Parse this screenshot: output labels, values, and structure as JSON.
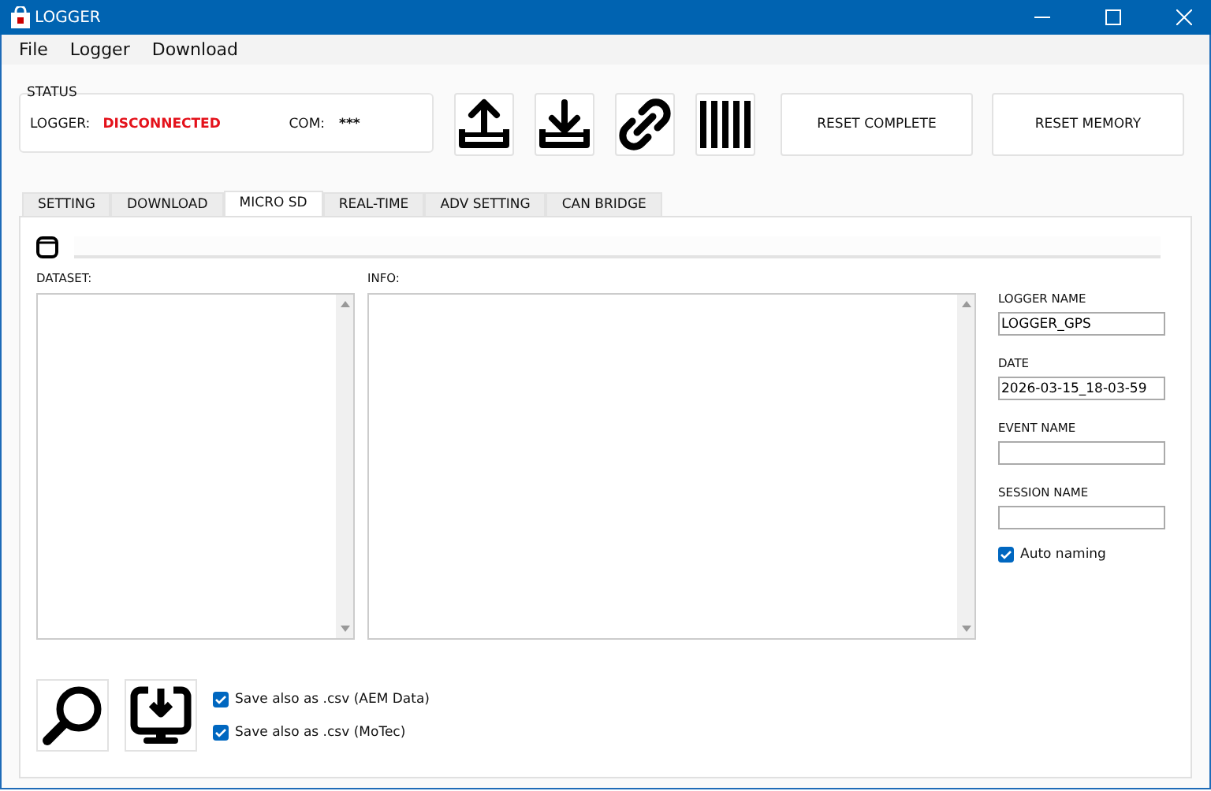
{
  "window": {
    "title": "LOGGER"
  },
  "menu": [
    "File",
    "Logger",
    "Download"
  ],
  "status": {
    "title": "STATUS",
    "logger_label": "LOGGER:",
    "logger_value": "DISCONNECTED",
    "com_label": "COM:",
    "com_value": "***"
  },
  "toolbar": [
    {
      "kind": "upload"
    },
    {
      "kind": "download"
    },
    {
      "kind": "link"
    },
    {
      "kind": "barcode"
    }
  ],
  "actions": [
    "RESET COMPLETE",
    "RESET MEMORY"
  ],
  "tabs": [
    {
      "label": "SETTING",
      "selected": false
    },
    {
      "label": "DOWNLOAD",
      "selected": false
    },
    {
      "label": "MICRO SD",
      "selected": true
    },
    {
      "label": "REAL-TIME",
      "selected": false
    },
    {
      "label": "ADV SETTING",
      "selected": false
    },
    {
      "label": "CAN BRIDGE",
      "selected": false
    }
  ],
  "progress": {
    "level": 0
  },
  "dataset": {
    "label": "DATASET:"
  },
  "info": {
    "label": "INFO:"
  },
  "fields": [
    {
      "label": "LOGGER NAME",
      "value": "LOGGER_GPS"
    },
    {
      "label": "DATE",
      "value": "2026-03-15_18-03-59"
    },
    {
      "label": "EVENT NAME"
    },
    {
      "label": "SESSION NAME"
    }
  ],
  "auto_naming": {
    "label": "Auto naming",
    "checked": true
  },
  "bottom_buttons": [
    {
      "kind": "search"
    },
    {
      "kind": "save"
    }
  ],
  "options": [
    {
      "label": "Save also as .csv (AEM Data)",
      "checked": true
    },
    {
      "label": "Save also as .csv (MoTec)",
      "checked": true
    }
  ]
}
